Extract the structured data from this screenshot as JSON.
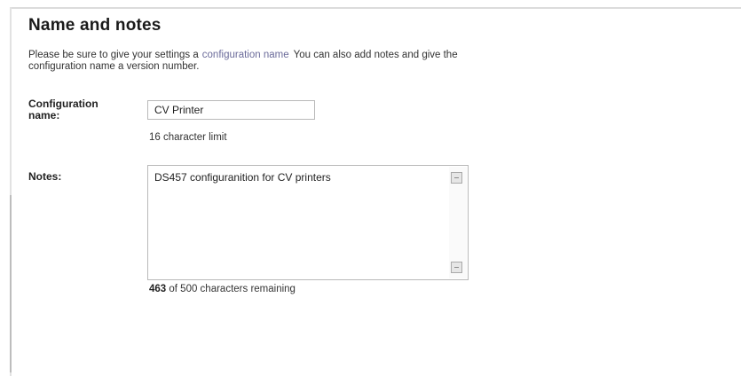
{
  "section": {
    "title": "Name and notes"
  },
  "intro": {
    "text_before": "Please be sure to give your settings a",
    "link": "configuration name",
    "text_after": "You can also add notes and give the configuration name a version number."
  },
  "config": {
    "label": "Configuration name:",
    "value": "CV Printer",
    "hint": "16 character limit"
  },
  "notes": {
    "label": "Notes:",
    "value": "DS457 configuranition for CV printers",
    "remaining_count": "463",
    "remaining_text": "of 500 characters remaining"
  }
}
